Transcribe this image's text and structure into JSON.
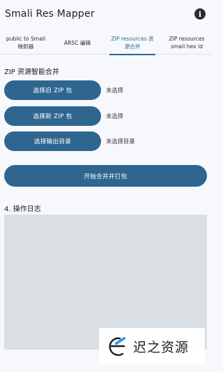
{
  "app": {
    "title": "Smali Res Mapper",
    "info_icon": "info-icon",
    "info_glyph": "i"
  },
  "tabs": [
    {
      "label": "public to Smali\n映射器",
      "active": false
    },
    {
      "label": "ARSC 编辑",
      "active": false
    },
    {
      "label": "ZIP resources 资\n源合并",
      "active": true
    },
    {
      "label": "ZIP resources\nsmali hex id",
      "active": false
    }
  ],
  "merge": {
    "section_title": "ZIP 资源智能合并",
    "old_zip": {
      "button_label": "选择旧 ZIP 包",
      "status": "未选择"
    },
    "new_zip": {
      "button_label": "选择新 ZIP 包",
      "status": "未选择"
    },
    "output_dir": {
      "button_label": "选择输出目录",
      "status": "未选择目录"
    },
    "start_button_label": "开始合并并打包"
  },
  "log": {
    "title": "4. 操作日志",
    "content": ""
  },
  "watermark": {
    "text": "迟之资源"
  },
  "colors": {
    "accent": "#2f6690",
    "active_tab": "#2b6892",
    "log_bg": "#dadfe3",
    "page_bg": "#f7f8fc"
  }
}
